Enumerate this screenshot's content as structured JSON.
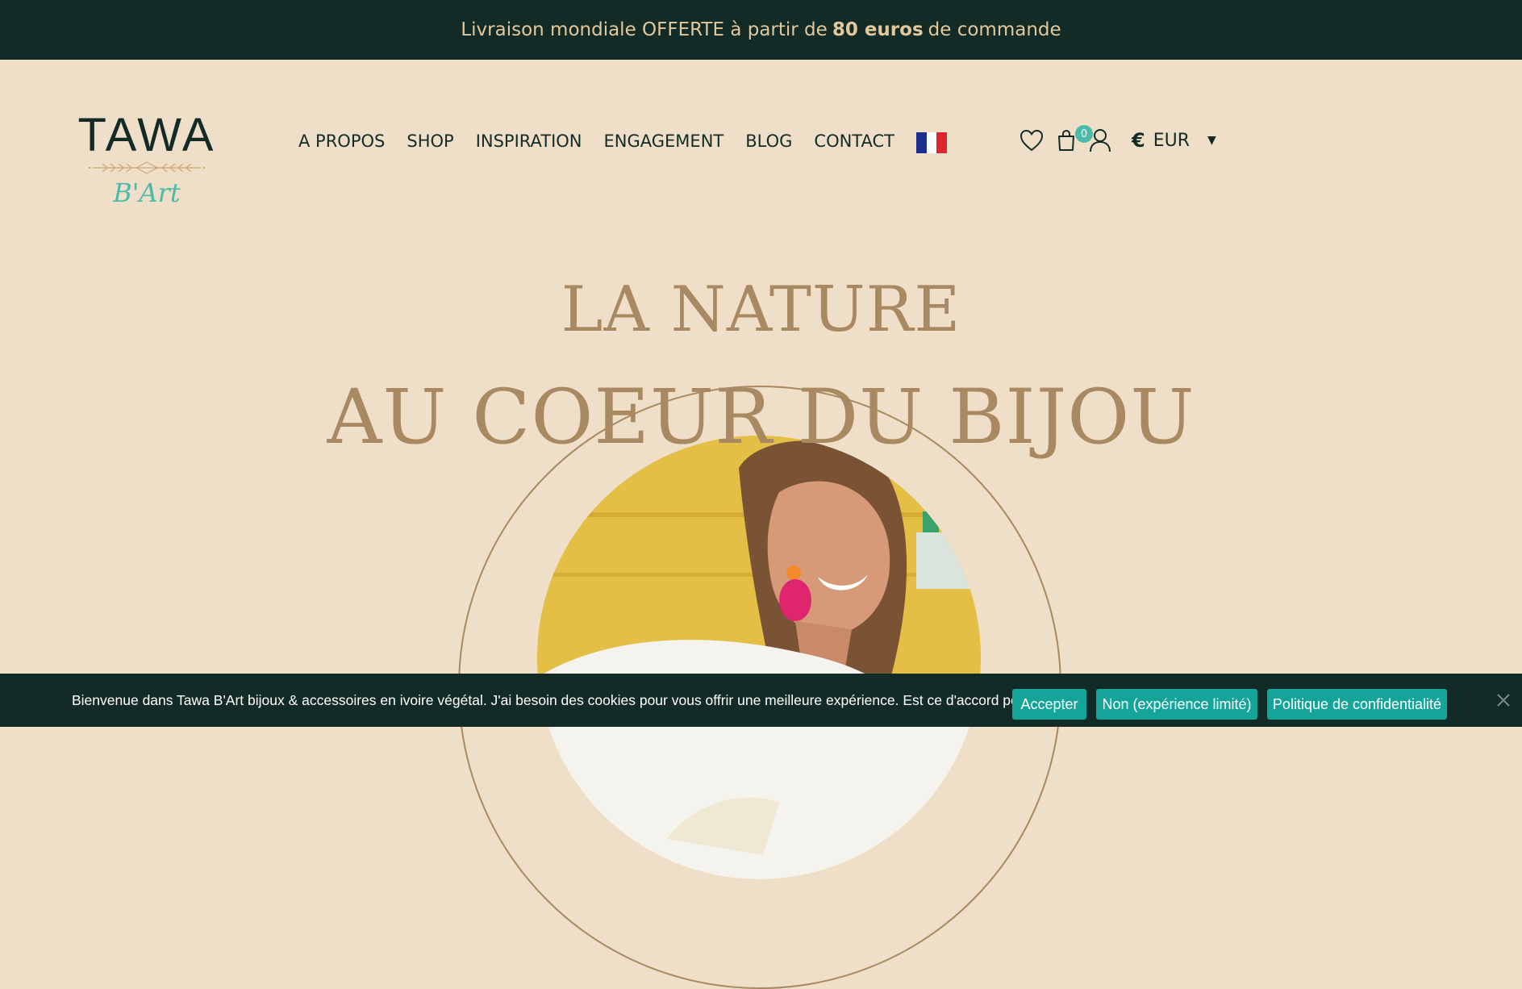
{
  "announcement": {
    "prefix": "Livraison mondiale OFFERTE à partir de",
    "highlight": "80 euros",
    "suffix": "de commande"
  },
  "logo": {
    "name": "TAWA",
    "subname": "B'Art"
  },
  "nav": {
    "items": [
      "A PROPOS",
      "SHOP",
      "INSPIRATION",
      "ENGAGEMENT",
      "BLOG",
      "CONTACT"
    ],
    "language": "french-flag"
  },
  "header_icons": {
    "wishlist": "heart-icon",
    "cart": "shopping-bag-icon",
    "account": "user-icon",
    "cart_count": "0",
    "currency_symbol": "€",
    "currency_code": "EUR"
  },
  "hero": {
    "line1": "LA NATURE",
    "line2": "AU COEUR DU BIJOU"
  },
  "cookie_banner": {
    "message": "Bienvenue dans Tawa B'Art bijoux & accessoires en ivoire végétal. J'ai besoin des cookies pour vous offrir une meilleure expérience. Est ce d'accord pour vous?",
    "accept_label": "Accepter",
    "decline_label": "Non (expérience limité)",
    "privacy_label": "Politique de confidentialité"
  },
  "colors": {
    "dark_green": "#132b26",
    "beige_bg": "#f0dfc8",
    "gold": "#a88962",
    "teal": "#4cbaa9",
    "button_teal": "#15a49a"
  }
}
